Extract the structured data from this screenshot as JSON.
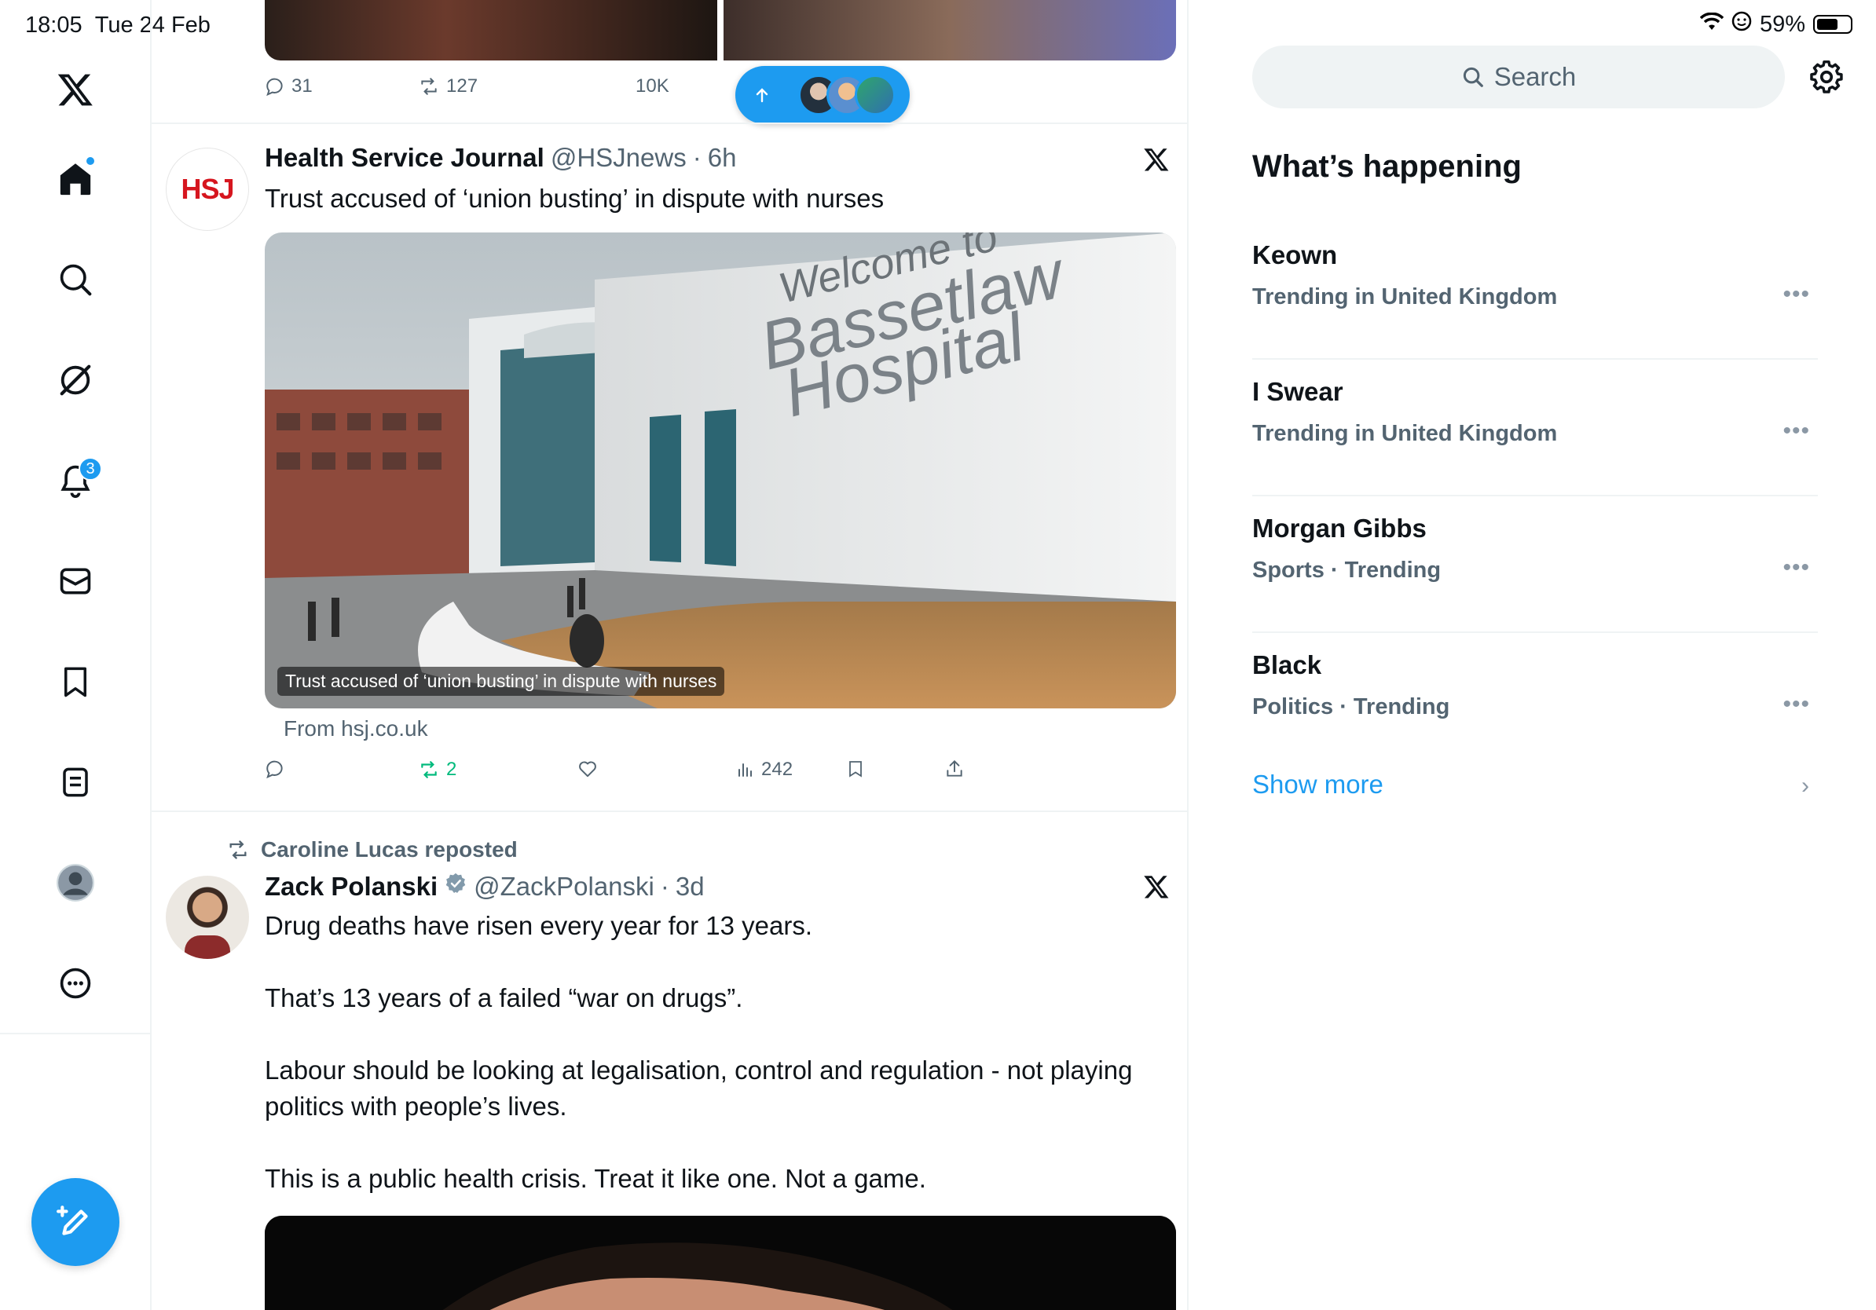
{
  "status_bar": {
    "time": "18:05",
    "date": "Tue 24 Feb",
    "battery": "59%"
  },
  "nav": {
    "items": [
      "x-logo",
      "home",
      "search",
      "grok",
      "notifications",
      "messages",
      "bookmarks",
      "lists",
      "profile",
      "more"
    ],
    "notifications_badge": "3",
    "compose_label": "Post"
  },
  "top_tweet_actions": {
    "replies": "31",
    "reposts": "127",
    "views": "10K"
  },
  "hsj_tweet": {
    "avatar_text": "HSJ",
    "name": "Health Service Journal",
    "handle": "@HSJnews",
    "time": "6h",
    "text": "Trust accused of ‘union busting’ in dispute with nurses",
    "sign_line1": "Welcome to",
    "sign_line2": "Bassetlaw",
    "sign_line3": "Hospital",
    "card_caption": "Trust accused of ‘union busting’ in dispute with nurses",
    "from": "From hsj.co.uk",
    "actions": {
      "replies": "",
      "reposts": "2",
      "likes": "",
      "views": "242"
    }
  },
  "polanski_tweet": {
    "reposted_by": "Caroline Lucas reposted",
    "name": "Zack Polanski",
    "handle": "@ZackPolanski",
    "time": "3d",
    "paragraphs": [
      "Drug deaths have risen every year for 13 years.",
      "That’s 13 years of a failed “war on drugs”.",
      "Labour should be looking at legalisation, control and regulation - not playing politics with people’s lives.",
      "This is a public health crisis. Treat it like one. Not a game."
    ]
  },
  "sidebar": {
    "search_placeholder": "Search",
    "whats_happening": "What’s happening",
    "trends": [
      {
        "name": "Keown",
        "context": "Trending in United Kingdom"
      },
      {
        "name": "I Swear",
        "context": "Trending in United Kingdom"
      },
      {
        "name": "Morgan Gibbs",
        "context": "Sports · Trending"
      },
      {
        "name": "Black",
        "context": "Politics · Trending"
      }
    ],
    "show_more": "Show more"
  },
  "colors": {
    "accent": "#1d9bf0",
    "repost_green": "#00ba7c",
    "secondary_text": "#536471",
    "border": "#eff3f4"
  }
}
